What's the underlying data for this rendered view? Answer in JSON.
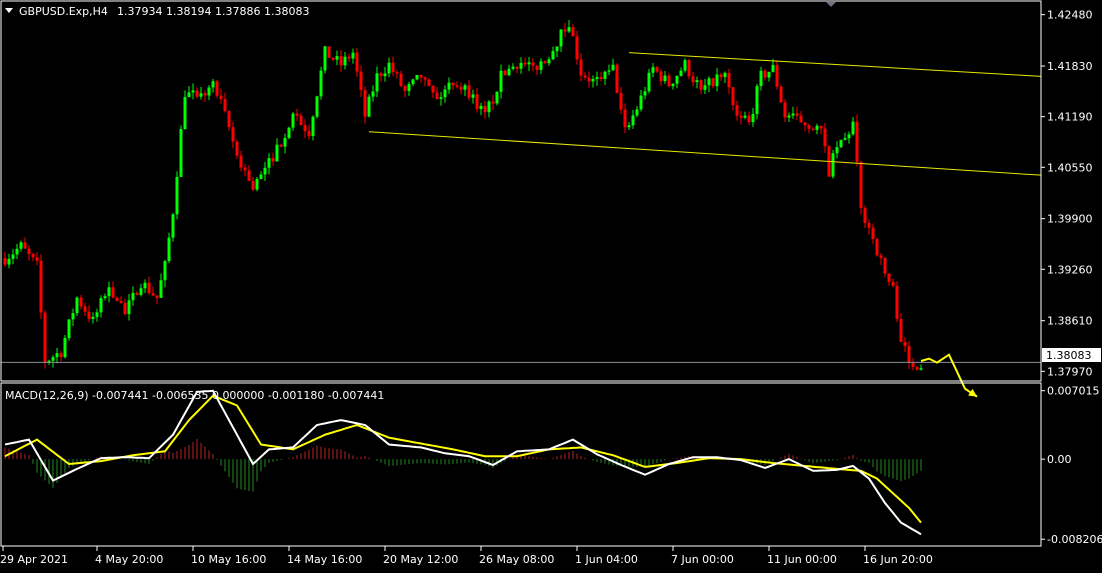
{
  "chart_data": [
    {
      "type": "candlestick",
      "title": "GBPUSD.Exp,H4",
      "ohlc_header": "1.37934 1.38194 1.37886 1.38083",
      "current_price": 1.38083,
      "current_price_label": "1.38083",
      "x_ticks": [
        "29 Apr 2021",
        "4 May 20:00",
        "10 May 16:00",
        "14 May 16:00",
        "20 May 12:00",
        "26 May 08:00",
        "1 Jun 04:00",
        "7 Jun 00:00",
        "11 Jun 00:00",
        "16 Jun 20:00"
      ],
      "y_ticks": [
        1.4248,
        1.4183,
        1.4119,
        1.4055,
        1.399,
        1.3926,
        1.3861,
        1.3797
      ],
      "y_tick_labels": [
        "1.42480",
        "1.41830",
        "1.41190",
        "1.40550",
        "1.39900",
        "1.39260",
        "1.38610",
        "1.37970"
      ],
      "ylim": [
        1.3786,
        1.4264
      ],
      "bar_count": 230,
      "anchors": [
        [
          0,
          1.394
        ],
        [
          4,
          1.3955
        ],
        [
          8,
          1.393
        ],
        [
          10,
          1.381
        ],
        [
          14,
          1.3822
        ],
        [
          18,
          1.389
        ],
        [
          22,
          1.386
        ],
        [
          26,
          1.3905
        ],
        [
          30,
          1.387
        ],
        [
          34,
          1.391
        ],
        [
          38,
          1.389
        ],
        [
          40,
          1.393
        ],
        [
          42,
          1.4
        ],
        [
          45,
          1.415
        ],
        [
          48,
          1.414
        ],
        [
          52,
          1.416
        ],
        [
          55,
          1.412
        ],
        [
          58,
          1.407
        ],
        [
          62,
          1.403
        ],
        [
          65,
          1.405
        ],
        [
          68,
          1.408
        ],
        [
          72,
          1.412
        ],
        [
          76,
          1.41
        ],
        [
          80,
          1.42
        ],
        [
          84,
          1.4185
        ],
        [
          87,
          1.42
        ],
        [
          90,
          1.412
        ],
        [
          93,
          1.417
        ],
        [
          96,
          1.4185
        ],
        [
          100,
          1.415
        ],
        [
          104,
          1.417
        ],
        [
          108,
          1.414
        ],
        [
          112,
          1.4165
        ],
        [
          116,
          1.415
        ],
        [
          120,
          1.412
        ],
        [
          124,
          1.417
        ],
        [
          128,
          1.419
        ],
        [
          132,
          1.418
        ],
        [
          135,
          1.419
        ],
        [
          138,
          1.4215
        ],
        [
          141,
          1.424
        ],
        [
          144,
          1.4175
        ],
        [
          148,
          1.416
        ],
        [
          152,
          1.418
        ],
        [
          155,
          1.41
        ],
        [
          158,
          1.413
        ],
        [
          162,
          1.418
        ],
        [
          166,
          1.416
        ],
        [
          170,
          1.4185
        ],
        [
          174,
          1.415
        ],
        [
          177,
          1.4165
        ],
        [
          180,
          1.417
        ],
        [
          183,
          1.412
        ],
        [
          186,
          1.411
        ],
        [
          189,
          1.417
        ],
        [
          192,
          1.418
        ],
        [
          195,
          1.412
        ],
        [
          198,
          1.4115
        ],
        [
          201,
          1.411
        ],
        [
          204,
          1.41
        ],
        [
          206,
          1.405
        ],
        [
          208,
          1.408
        ],
        [
          210,
          1.409
        ],
        [
          212,
          1.411
        ],
        [
          214,
          1.4
        ],
        [
          216,
          1.398
        ],
        [
          218,
          1.395
        ],
        [
          220,
          1.392
        ],
        [
          222,
          1.39
        ],
        [
          224,
          1.384
        ],
        [
          226,
          1.3805
        ],
        [
          229,
          1.3808
        ]
      ],
      "trendlines": [
        {
          "from": [
            156,
            1.42
          ],
          "to": [
            260,
            1.417
          ]
        },
        {
          "from": [
            91,
            1.41
          ],
          "to": [
            260,
            1.4045
          ]
        }
      ],
      "arrows": [
        {
          "points": [
            [
              229,
              1.381
            ],
            [
              231,
              1.3813
            ],
            [
              233,
              1.3808
            ],
            [
              236,
              1.3818
            ],
            [
              240,
              1.3775
            ],
            [
              243,
              1.3765
            ]
          ]
        }
      ]
    },
    {
      "type": "macd",
      "title": "MACD(12,26,9) -0.007441 -0.006535 0.000000 -0.001180 -0.007441",
      "y_ticks": [
        0.007015,
        0.0,
        -0.008206
      ],
      "y_tick_labels": [
        "0.007015",
        "0.00",
        "-0.008206"
      ],
      "ylim": [
        -0.0088,
        0.0077
      ],
      "macd_anchors": [
        [
          0,
          0.0015
        ],
        [
          6,
          0.002
        ],
        [
          12,
          -0.0022
        ],
        [
          18,
          -0.001
        ],
        [
          24,
          0.0001
        ],
        [
          30,
          0.0002
        ],
        [
          36,
          0.0001
        ],
        [
          42,
          0.0025
        ],
        [
          48,
          0.0069
        ],
        [
          52,
          0.007
        ],
        [
          56,
          0.004
        ],
        [
          62,
          -0.0005
        ],
        [
          66,
          0.001
        ],
        [
          72,
          0.0012
        ],
        [
          78,
          0.0035
        ],
        [
          84,
          0.004
        ],
        [
          90,
          0.0035
        ],
        [
          96,
          0.0015
        ],
        [
          104,
          0.0012
        ],
        [
          110,
          0.0006
        ],
        [
          116,
          0.0003
        ],
        [
          122,
          -0.0006
        ],
        [
          128,
          0.0008
        ],
        [
          136,
          0.001
        ],
        [
          142,
          0.002
        ],
        [
          148,
          0.0005
        ],
        [
          154,
          -0.0006
        ],
        [
          160,
          -0.0016
        ],
        [
          166,
          -0.0005
        ],
        [
          172,
          0.0002
        ],
        [
          178,
          0.0002
        ],
        [
          184,
          -0.0001
        ],
        [
          190,
          -0.0009
        ],
        [
          196,
          0.0
        ],
        [
          202,
          -0.0012
        ],
        [
          208,
          -0.0011
        ],
        [
          212,
          -0.0007
        ],
        [
          216,
          -0.002
        ],
        [
          220,
          -0.0045
        ],
        [
          224,
          -0.0065
        ],
        [
          229,
          -0.0077
        ]
      ],
      "signal_anchors": [
        [
          0,
          0.0003
        ],
        [
          8,
          0.002
        ],
        [
          16,
          -0.0005
        ],
        [
          24,
          -0.0002
        ],
        [
          32,
          0.0004
        ],
        [
          40,
          0.0008
        ],
        [
          46,
          0.004
        ],
        [
          52,
          0.0065
        ],
        [
          58,
          0.0055
        ],
        [
          64,
          0.0015
        ],
        [
          72,
          0.001
        ],
        [
          80,
          0.0025
        ],
        [
          88,
          0.0035
        ],
        [
          96,
          0.0022
        ],
        [
          104,
          0.0016
        ],
        [
          112,
          0.001
        ],
        [
          120,
          0.0003
        ],
        [
          128,
          0.0003
        ],
        [
          136,
          0.001
        ],
        [
          144,
          0.0012
        ],
        [
          152,
          0.0004
        ],
        [
          160,
          -0.0008
        ],
        [
          168,
          -0.0004
        ],
        [
          176,
          0.0001
        ],
        [
          184,
          0.0
        ],
        [
          192,
          -0.0004
        ],
        [
          200,
          -0.0007
        ],
        [
          208,
          -0.001
        ],
        [
          214,
          -0.0012
        ],
        [
          218,
          -0.002
        ],
        [
          222,
          -0.0035
        ],
        [
          226,
          -0.005
        ],
        [
          229,
          -0.0065
        ]
      ],
      "colors": {
        "macd_line": "#FFFFFF",
        "signal_line": "#FFFF00",
        "hist_up": "#B22222",
        "hist_down": "#228B22"
      }
    }
  ],
  "colors": {
    "background": "#000000",
    "up_candle": "#00FF00",
    "down_candle": "#FF0000",
    "frame": "#FFFFFF",
    "text": "#FFFFFF",
    "trendline": "#E8E800",
    "arrow": "#FFFF00",
    "price_line": "#8A8F99"
  }
}
